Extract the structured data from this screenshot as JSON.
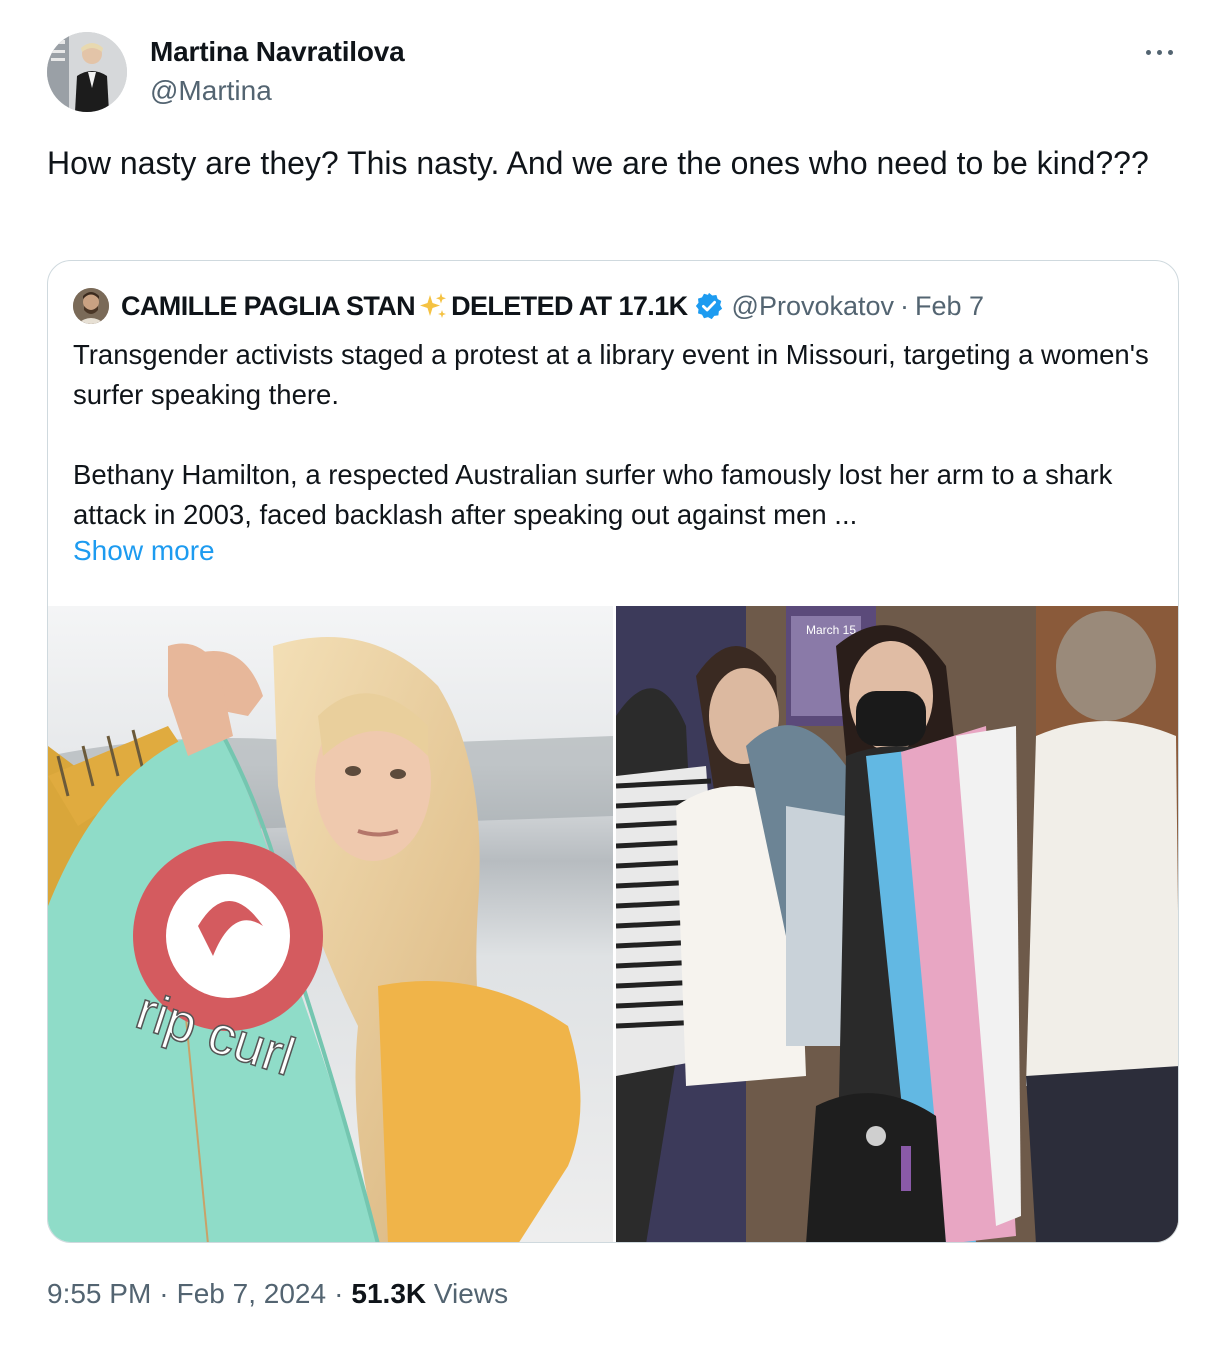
{
  "tweet": {
    "author_name": "Martina Navratilova",
    "author_handle": "@Martina",
    "text": "How nasty are they? This nasty. And we are the ones who need to be kind???",
    "time": "9:55 PM",
    "date": "Feb 7, 2024",
    "views_count": "51.3K",
    "views_label": "Views",
    "separator": "·"
  },
  "quote": {
    "name_part1": "CAMILLE PAGLIA STAN",
    "name_part2": "DELETED AT 17.1K",
    "handle": "@Provokatov",
    "separator": "·",
    "date": "Feb 7",
    "body": "Transgender activists staged a protest at a library event in Missouri, targeting a women's surfer speaking there.\n\nBethany Hamilton, a respected Australian surfer who famously lost her arm to a shark attack in 2003, faced backlash after speaking out against men ...",
    "show_more": "Show more",
    "images": [
      {
        "brand_text": "rip curl"
      },
      {
        "sign_text": "March 15"
      }
    ]
  },
  "colors": {
    "accent": "#1d9bf0",
    "secondary_text": "#536471",
    "border": "#cfd9de"
  },
  "icons": {
    "more": "more-horizontal-icon",
    "sparkle": "sparkles-icon",
    "verified": "verified-badge-icon"
  }
}
